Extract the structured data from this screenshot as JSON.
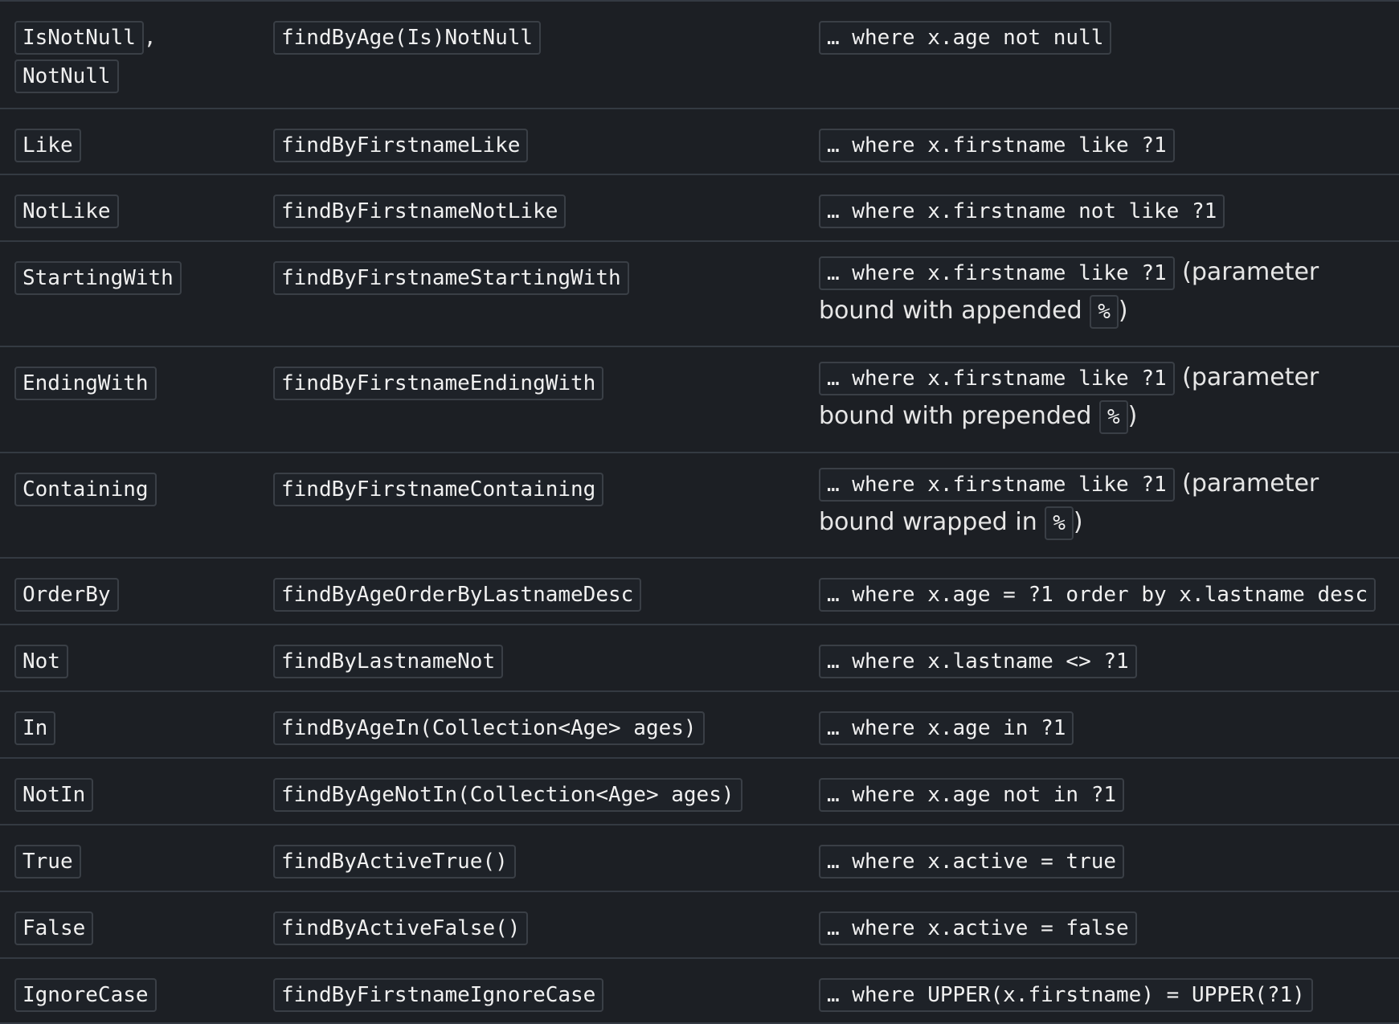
{
  "rows": [
    {
      "keyword": [
        "IsNotNull",
        "NotNull"
      ],
      "sample": "findByAge(Is)NotNull",
      "jpql": "… where x.age not null"
    },
    {
      "keyword": [
        "Like"
      ],
      "sample": "findByFirstnameLike",
      "jpql": "… where x.firstname like ?1"
    },
    {
      "keyword": [
        "NotLike"
      ],
      "sample": "findByFirstnameNotLike",
      "jpql": "… where x.firstname not like ?1"
    },
    {
      "keyword": [
        "StartingWith"
      ],
      "sample": "findByFirstnameStartingWith",
      "jpql": "… where x.firstname like ?1",
      "note_pre": " (parameter bound with appended ",
      "note_code": "%",
      "note_post": ")"
    },
    {
      "keyword": [
        "EndingWith"
      ],
      "sample": "findByFirstnameEndingWith",
      "jpql": "… where x.firstname like ?1",
      "note_pre": " (parameter bound with prepended ",
      "note_code": "%",
      "note_post": ")"
    },
    {
      "keyword": [
        "Containing"
      ],
      "sample": "findByFirstnameContaining",
      "jpql": "… where x.firstname like ?1",
      "note_pre": " (parameter bound wrapped in ",
      "note_code": "%",
      "note_post": ")"
    },
    {
      "keyword": [
        "OrderBy"
      ],
      "sample": "findByAgeOrderByLastnameDesc",
      "jpql": "… where x.age = ?1 order by x.lastname desc"
    },
    {
      "keyword": [
        "Not"
      ],
      "sample": "findByLastnameNot",
      "jpql": "… where x.lastname <> ?1"
    },
    {
      "keyword": [
        "In"
      ],
      "sample": "findByAgeIn(Collection<Age> ages)",
      "jpql": "… where x.age in ?1"
    },
    {
      "keyword": [
        "NotIn"
      ],
      "sample": "findByAgeNotIn(Collection<Age> ages)",
      "jpql": "… where x.age not in ?1"
    },
    {
      "keyword": [
        "True"
      ],
      "sample": "findByActiveTrue()",
      "jpql": "… where x.active = true"
    },
    {
      "keyword": [
        "False"
      ],
      "sample": "findByActiveFalse()",
      "jpql": "… where x.active = false"
    },
    {
      "keyword": [
        "IgnoreCase"
      ],
      "sample": "findByFirstnameIgnoreCase",
      "jpql": "… where UPPER(x.firstname) = UPPER(?1)"
    }
  ],
  "keyword_separator": ","
}
